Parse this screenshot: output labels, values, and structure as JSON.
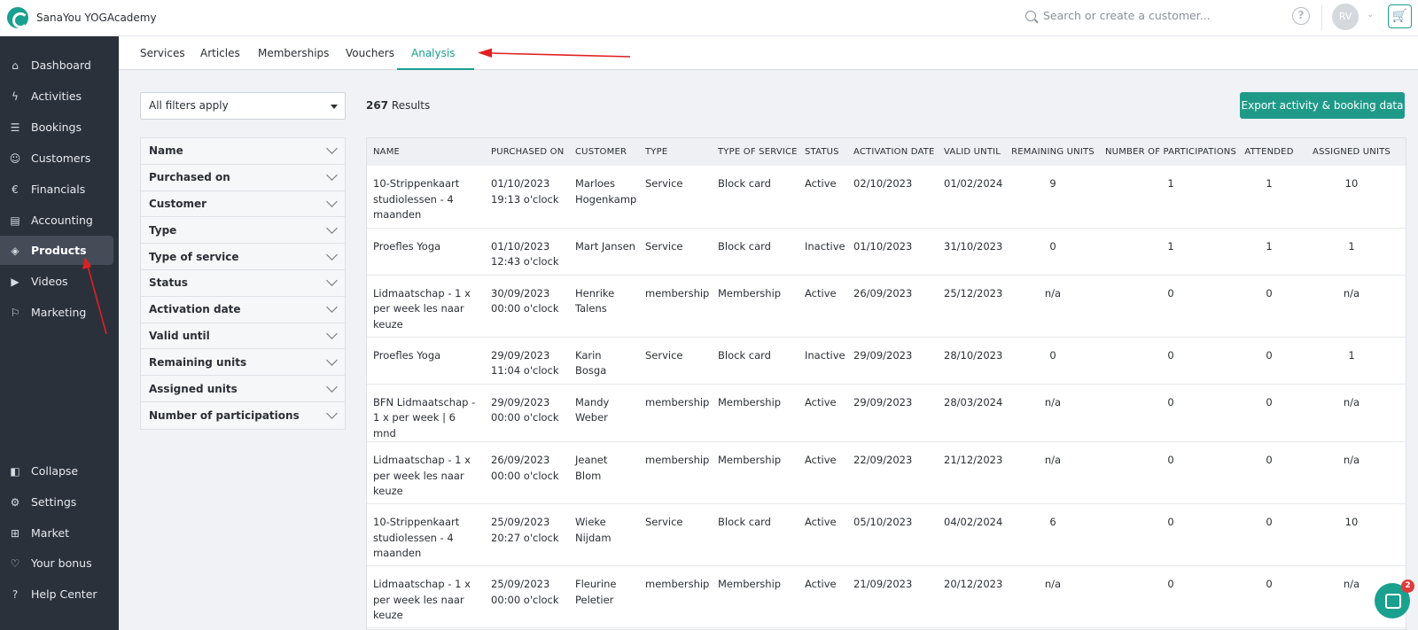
{
  "header": {
    "brand": "SanaYou YOGAcademy",
    "search_placeholder": "Search or create a customer...",
    "help_icon": "?",
    "avatar_initials": "RV",
    "cart_icon": "🛒"
  },
  "sidebar": {
    "items": [
      {
        "label": "Dashboard",
        "icon": "⌂"
      },
      {
        "label": "Activities",
        "icon": "ϟ"
      },
      {
        "label": "Bookings",
        "icon": "☰"
      },
      {
        "label": "Customers",
        "icon": "☺"
      },
      {
        "label": "Financials",
        "icon": "€"
      },
      {
        "label": "Accounting",
        "icon": "▤"
      },
      {
        "label": "Products",
        "icon": "◈"
      },
      {
        "label": "Videos",
        "icon": "▶"
      },
      {
        "label": "Marketing",
        "icon": "⚐"
      }
    ],
    "bottom_items": [
      {
        "label": "Collapse",
        "icon": "◧"
      },
      {
        "label": "Settings",
        "icon": "⚙"
      },
      {
        "label": "Market",
        "icon": "⊞"
      },
      {
        "label": "Your bonus",
        "icon": "♡"
      },
      {
        "label": "Help Center",
        "icon": "?"
      }
    ]
  },
  "tabs": [
    {
      "label": "Services"
    },
    {
      "label": "Articles"
    },
    {
      "label": "Memberships"
    },
    {
      "label": "Vouchers"
    },
    {
      "label": "Analysis"
    }
  ],
  "filter_select": {
    "value": "All filters apply"
  },
  "filters": [
    "Name",
    "Purchased on",
    "Customer",
    "Type",
    "Type of service",
    "Status",
    "Activation date",
    "Valid until",
    "Remaining units",
    "Assigned units",
    "Number of participations"
  ],
  "results": {
    "count": "267",
    "label": "Results"
  },
  "export_button": "Export activity & booking data",
  "table": {
    "columns": [
      "NAME",
      "PURCHASED ON",
      "CUSTOMER",
      "TYPE",
      "TYPE OF SERVICE",
      "STATUS",
      "ACTIVATION DATE",
      "VALID UNTIL",
      "REMAINING UNITS",
      "NUMBER OF PARTICIPATIONS",
      "ATTENDED",
      "ASSIGNED UNITS"
    ],
    "rows": [
      {
        "name": "10-Strippenkaart studiolessen - 4 maanden",
        "purchased_date": "01/10/2023",
        "purchased_time": "19:13 o'clock",
        "customer": "Marloes Hogenkamp",
        "type": "Service",
        "service": "Block card",
        "status": "Active",
        "activation": "02/10/2023",
        "valid": "01/02/2024",
        "remaining": "9",
        "participations": "1",
        "attended": "1",
        "assigned": "10"
      },
      {
        "name": "Proefles Yoga",
        "purchased_date": "01/10/2023",
        "purchased_time": "12:43 o'clock",
        "customer": "Mart Jansen",
        "type": "Service",
        "service": "Block card",
        "status": "Inactive",
        "activation": "01/10/2023",
        "valid": "31/10/2023",
        "remaining": "0",
        "participations": "1",
        "attended": "1",
        "assigned": "1"
      },
      {
        "name": "Lidmaatschap - 1 x per week les naar keuze",
        "purchased_date": "30/09/2023",
        "purchased_time": "00:00 o'clock",
        "customer": "Henrike Talens",
        "type": "membership",
        "service": "Membership",
        "status": "Active",
        "activation": "26/09/2023",
        "valid": "25/12/2023",
        "remaining": "n/a",
        "participations": "0",
        "attended": "0",
        "assigned": "n/a"
      },
      {
        "name": "Proefles Yoga",
        "purchased_date": "29/09/2023",
        "purchased_time": "11:04 o'clock",
        "customer": "Karin Bosga",
        "type": "Service",
        "service": "Block card",
        "status": "Inactive",
        "activation": "29/09/2023",
        "valid": "28/10/2023",
        "remaining": "0",
        "participations": "0",
        "attended": "0",
        "assigned": "1"
      },
      {
        "name": "BFN Lidmaatschap - 1 x per week | 6 mnd",
        "purchased_date": "29/09/2023",
        "purchased_time": "00:00 o'clock",
        "customer": "Mandy Weber",
        "type": "membership",
        "service": "Membership",
        "status": "Active",
        "activation": "29/09/2023",
        "valid": "28/03/2024",
        "remaining": "n/a",
        "participations": "0",
        "attended": "0",
        "assigned": "n/a"
      },
      {
        "name": "Lidmaatschap - 1 x per week les naar keuze",
        "purchased_date": "26/09/2023",
        "purchased_time": "00:00 o'clock",
        "customer": "Jeanet Blom",
        "type": "membership",
        "service": "Membership",
        "status": "Active",
        "activation": "22/09/2023",
        "valid": "21/12/2023",
        "remaining": "n/a",
        "participations": "0",
        "attended": "0",
        "assigned": "n/a"
      },
      {
        "name": "10-Strippenkaart studiolessen - 4 maanden",
        "purchased_date": "25/09/2023",
        "purchased_time": "20:27 o'clock",
        "customer": "Wieke Nijdam",
        "type": "Service",
        "service": "Block card",
        "status": "Active",
        "activation": "05/10/2023",
        "valid": "04/02/2024",
        "remaining": "6",
        "participations": "0",
        "attended": "0",
        "assigned": "10"
      },
      {
        "name": "Lidmaatschap - 1 x per week les naar keuze",
        "purchased_date": "25/09/2023",
        "purchased_time": "00:00 o'clock",
        "customer": "Fleurine Peletier",
        "type": "membership",
        "service": "Membership",
        "status": "Active",
        "activation": "21/09/2023",
        "valid": "20/12/2023",
        "remaining": "n/a",
        "participations": "0",
        "attended": "0",
        "assigned": "n/a"
      }
    ]
  },
  "chat_badge": "2",
  "colors": {
    "accent": "#1aa08f",
    "sidebar": "#2b313b",
    "annotation": "#e02020"
  }
}
